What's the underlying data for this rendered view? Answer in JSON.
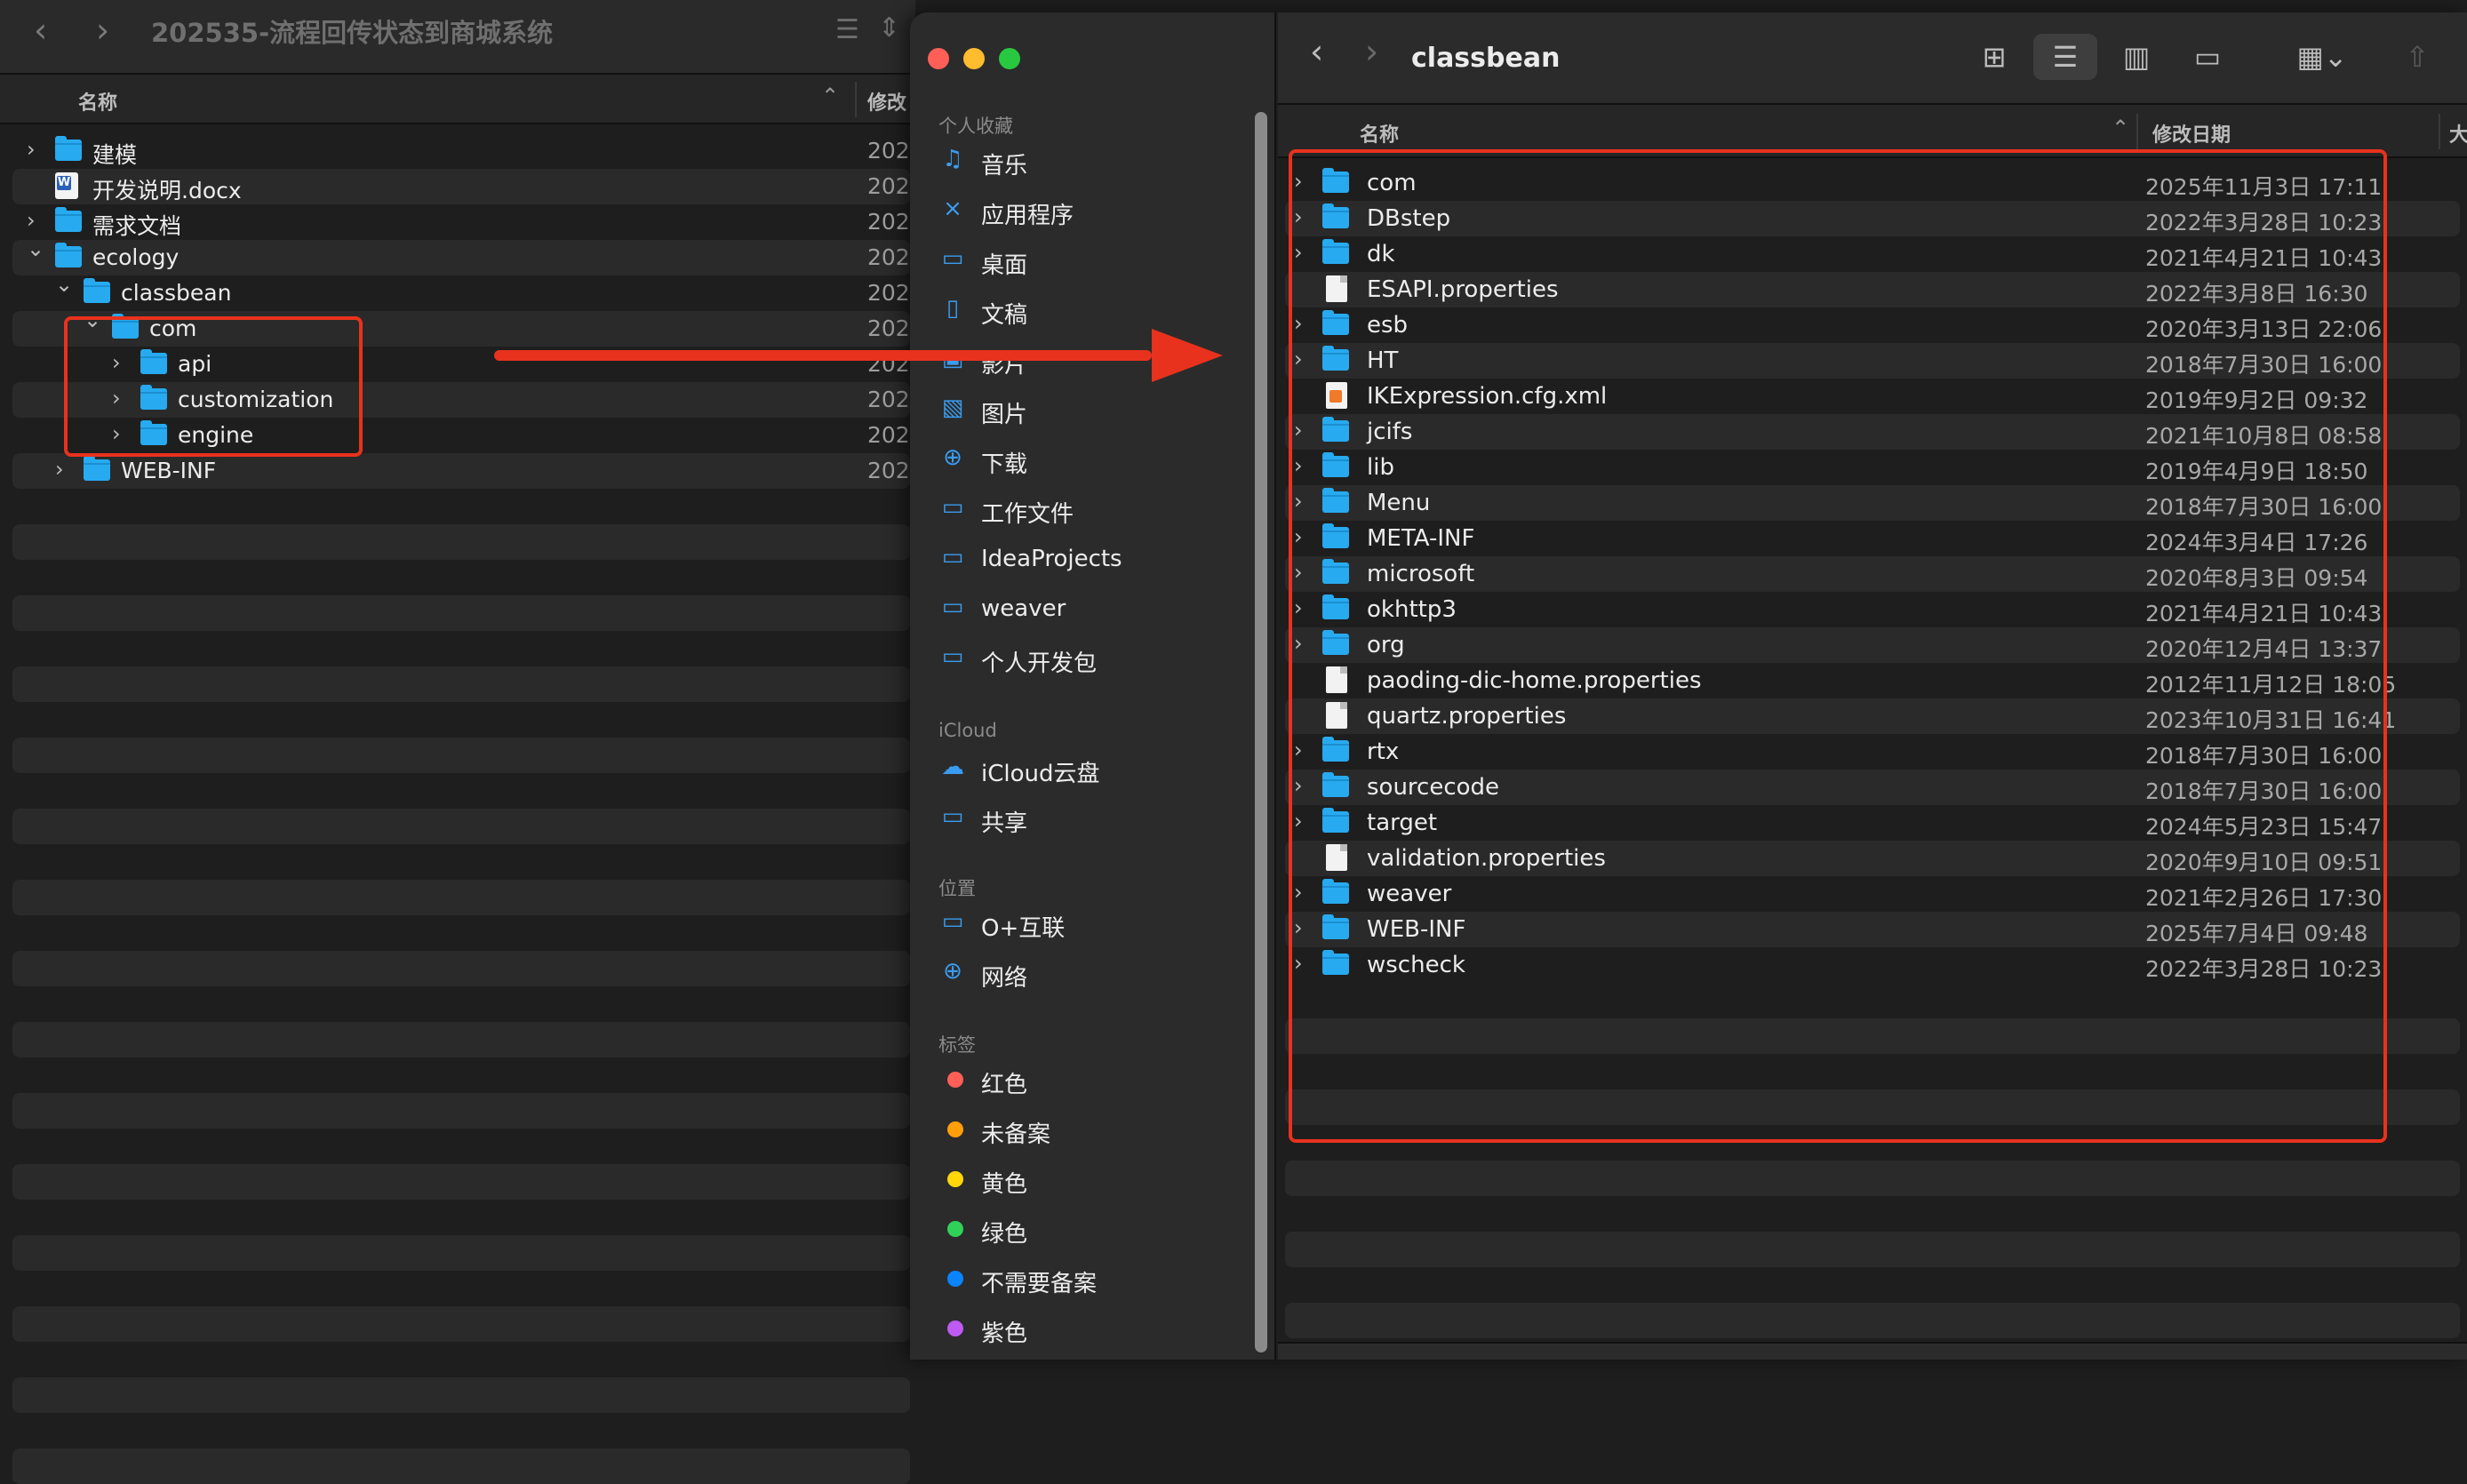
{
  "back_window": {
    "title": "202535-流程回传状态到商城系统",
    "nav_back": "‹",
    "nav_forward": "›",
    "column_name": "名称",
    "column_modified": "修改",
    "rows": [
      {
        "name": "建模",
        "date": "202",
        "icon": "folder-icon",
        "chevron": "›"
      },
      {
        "name": "开发说明.docx",
        "date": "202",
        "icon": "word-doc-icon",
        "chevron": ""
      },
      {
        "name": "需求文档",
        "date": "202",
        "icon": "folder-icon",
        "chevron": "›"
      },
      {
        "name": "ecology",
        "date": "202",
        "icon": "folder-icon",
        "chevron": "⌄"
      },
      {
        "name": "classbean",
        "date": "202",
        "icon": "folder-icon",
        "chevron": "⌄"
      },
      {
        "name": "com",
        "date": "202",
        "icon": "folder-icon",
        "chevron": "⌄"
      },
      {
        "name": "api",
        "date": "202",
        "icon": "folder-icon",
        "chevron": "›"
      },
      {
        "name": "customization",
        "date": "202",
        "icon": "folder-icon",
        "chevron": "›"
      },
      {
        "name": "engine",
        "date": "202",
        "icon": "folder-icon",
        "chevron": "›"
      },
      {
        "name": "WEB-INF",
        "date": "202",
        "icon": "folder-icon",
        "chevron": "›"
      }
    ]
  },
  "front_window": {
    "title": "classbean",
    "nav_back": "‹",
    "nav_forward": "›",
    "sidebar": {
      "favorites_header": "个人收藏",
      "favorites": [
        {
          "label": "音乐",
          "icon": "music-icon"
        },
        {
          "label": "应用程序",
          "icon": "applications-icon"
        },
        {
          "label": "桌面",
          "icon": "desktop-icon"
        },
        {
          "label": "文稿",
          "icon": "document-icon"
        },
        {
          "label": "影片",
          "icon": "movies-icon"
        },
        {
          "label": "图片",
          "icon": "photos-icon"
        },
        {
          "label": "下载",
          "icon": "download-icon"
        },
        {
          "label": "工作文件",
          "icon": "folder-icon"
        },
        {
          "label": "IdeaProjects",
          "icon": "folder-icon"
        },
        {
          "label": "weaver",
          "icon": "folder-icon"
        },
        {
          "label": "个人开发包",
          "icon": "folder-icon"
        }
      ],
      "icloud_header": "iCloud",
      "icloud": [
        {
          "label": "iCloud云盘",
          "icon": "cloud-icon"
        },
        {
          "label": "共享",
          "icon": "shared-folder-icon"
        }
      ],
      "locations_header": "位置",
      "locations": [
        {
          "label": "O+互联",
          "icon": "drive-icon"
        },
        {
          "label": "网络",
          "icon": "network-icon"
        }
      ],
      "tags_header": "标签",
      "tags": [
        {
          "label": "红色",
          "color": "#ff5f57"
        },
        {
          "label": "未备案",
          "color": "#ff9f0a"
        },
        {
          "label": "黄色",
          "color": "#ffd60a"
        },
        {
          "label": "绿色",
          "color": "#30d158"
        },
        {
          "label": "不需要备案",
          "color": "#0a84ff"
        },
        {
          "label": "紫色",
          "color": "#bf5af2"
        }
      ]
    },
    "column_name": "名称",
    "column_modified": "修改日期",
    "column_size": "大小",
    "rows": [
      {
        "name": "com",
        "date": "2025年11月3日 17:11",
        "type": "folder"
      },
      {
        "name": "DBstep",
        "date": "2022年3月28日 10:23",
        "type": "folder"
      },
      {
        "name": "dk",
        "date": "2021年4月21日 10:43",
        "type": "folder"
      },
      {
        "name": "ESAPI.properties",
        "date": "2022年3月8日 16:30",
        "type": "file"
      },
      {
        "name": "esb",
        "date": "2020年3月13日 22:06",
        "type": "folder"
      },
      {
        "name": "HT",
        "date": "2018年7月30日 16:00",
        "type": "folder"
      },
      {
        "name": "IKExpression.cfg.xml",
        "date": "2019年9月2日 09:32",
        "type": "xml"
      },
      {
        "name": "jcifs",
        "date": "2021年10月8日 08:58",
        "type": "folder"
      },
      {
        "name": "lib",
        "date": "2019年4月9日 18:50",
        "type": "folder"
      },
      {
        "name": "Menu",
        "date": "2018年7月30日 16:00",
        "type": "folder"
      },
      {
        "name": "META-INF",
        "date": "2024年3月4日 17:26",
        "type": "folder"
      },
      {
        "name": "microsoft",
        "date": "2020年8月3日 09:54",
        "type": "folder"
      },
      {
        "name": "okhttp3",
        "date": "2021年4月21日 10:43",
        "type": "folder"
      },
      {
        "name": "org",
        "date": "2020年12月4日 13:37",
        "type": "folder"
      },
      {
        "name": "paoding-dic-home.properties",
        "date": "2012年11月12日 18:05",
        "type": "file"
      },
      {
        "name": "quartz.properties",
        "date": "2023年10月31日 16:41",
        "type": "file"
      },
      {
        "name": "rtx",
        "date": "2018年7月30日 16:00",
        "type": "folder"
      },
      {
        "name": "sourcecode",
        "date": "2018年7月30日 16:00",
        "type": "folder"
      },
      {
        "name": "target",
        "date": "2024年5月23日 15:47",
        "type": "folder"
      },
      {
        "name": "validation.properties",
        "date": "2020年9月10日 09:51",
        "type": "file"
      },
      {
        "name": "weaver",
        "date": "2021年2月26日 17:30",
        "type": "folder"
      },
      {
        "name": "WEB-INF",
        "date": "2025年7月4日 09:48",
        "type": "folder"
      },
      {
        "name": "wscheck",
        "date": "2022年3月28日 10:23",
        "type": "folder"
      }
    ]
  },
  "annotation_color": "#e8321d"
}
